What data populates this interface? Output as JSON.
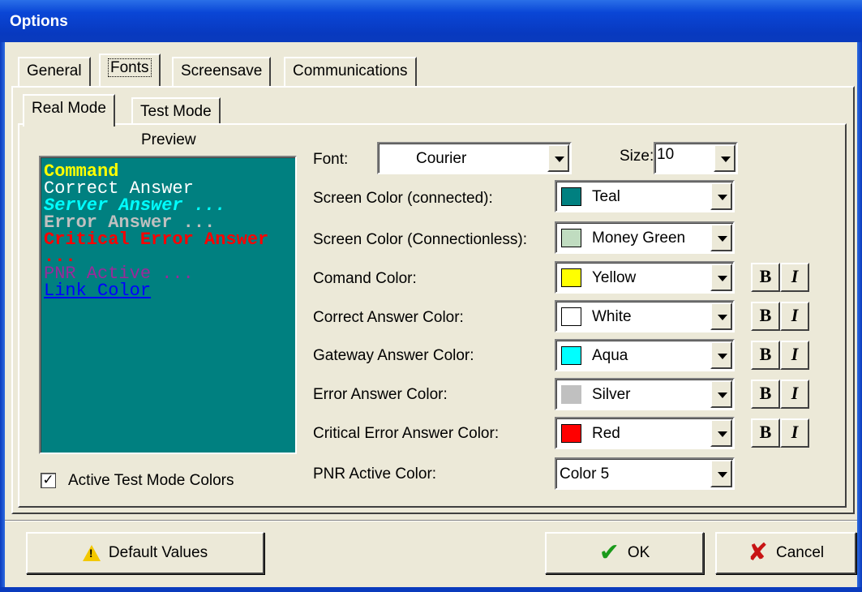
{
  "window": {
    "title": "Options"
  },
  "tabs": [
    {
      "label": "General",
      "selected": false
    },
    {
      "label": "Fonts",
      "selected": true
    },
    {
      "label": "Screensave",
      "selected": false
    },
    {
      "label": "Communications",
      "selected": false
    }
  ],
  "subtabs": [
    {
      "label": "Real Mode",
      "selected": true
    },
    {
      "label": "Test Mode",
      "selected": false
    }
  ],
  "preview": {
    "heading": "Preview",
    "lines": {
      "command": "Command",
      "correct": "Correct Answer",
      "server": "Server Answer ...",
      "error": "Error Answer ...",
      "critical": "Critical Error Answer ...",
      "pnr": "PNR Active ...",
      "link": "Link Color"
    },
    "colors": {
      "background": "#008080",
      "command": "#ffff00",
      "correct": "#ffffff",
      "server": "#00ffff",
      "error": "#c0c0c0",
      "critical": "#ff0000",
      "pnr": "#9a2a9a",
      "link": "#0000ff"
    }
  },
  "settings": {
    "font": {
      "label": "Font:",
      "value": "Courier"
    },
    "size": {
      "label": "Size:",
      "value": "10"
    },
    "screen_connected": {
      "label": "Screen Color (connected):",
      "value": "Teal",
      "swatch": "#008080"
    },
    "screen_connectionless": {
      "label": "Screen Color (Connectionless):",
      "value": "Money Green",
      "swatch": "#c0dcc0"
    },
    "command_color": {
      "label": "Comand Color:",
      "value": "Yellow",
      "swatch": "#ffff00"
    },
    "correct_color": {
      "label": "Correct Answer Color:",
      "value": "White",
      "swatch": "#ffffff"
    },
    "gateway_color": {
      "label": "Gateway Answer Color:",
      "value": "Aqua",
      "swatch": "#00ffff"
    },
    "error_color": {
      "label": "Error Answer Color:",
      "value": "Silver",
      "swatch": "#c0c0c0"
    },
    "critical_color": {
      "label": "Critical Error Answer Color:",
      "value": "Red",
      "swatch": "#ff0000"
    },
    "pnr_color": {
      "label": "PNR Active Color:",
      "value": "Color 5"
    }
  },
  "style_buttons": {
    "bold": "B",
    "italic": "I"
  },
  "checkbox": {
    "label": "Active Test Mode Colors",
    "checked": true,
    "mark": "✓"
  },
  "buttons": {
    "default": "Default Values",
    "ok": "OK",
    "cancel": "Cancel"
  },
  "icons": {
    "warning": "warning-icon",
    "check": "✔",
    "cross": "✘"
  }
}
